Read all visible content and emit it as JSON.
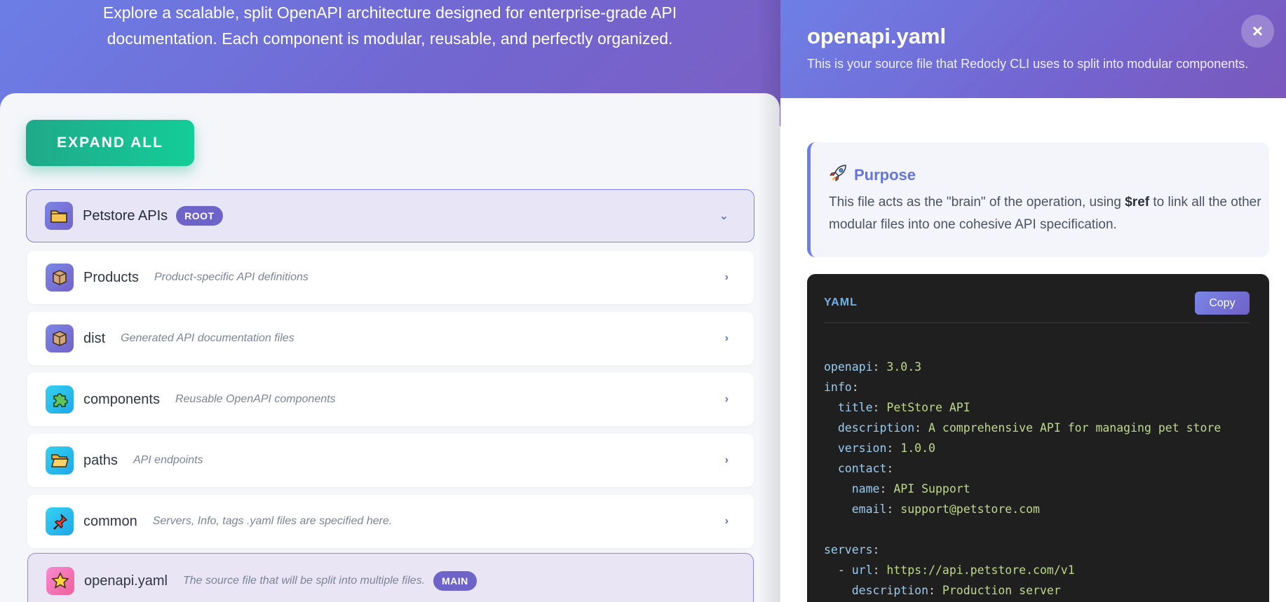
{
  "hero": {
    "line1": "Explore a scalable, split OpenAPI architecture designed for enterprise-grade API",
    "line2": "documentation. Each component is modular, reusable, and perfectly organized."
  },
  "toolbar": {
    "expand_label": "EXPAND ALL"
  },
  "tree": {
    "root": {
      "name": "Petstore APIs",
      "badge": "ROOT",
      "icon": "folder-icon"
    },
    "items": [
      {
        "name": "Products",
        "desc": "Product-specific API definitions",
        "icon": "package-icon"
      },
      {
        "name": "dist",
        "desc": "Generated API documentation files",
        "icon": "package-icon"
      },
      {
        "name": "components",
        "desc": "Reusable OpenAPI components",
        "icon": "puzzle-icon"
      },
      {
        "name": "paths",
        "desc": "API endpoints",
        "icon": "folder-open-icon"
      },
      {
        "name": "common",
        "desc": "Servers, Info, tags .yaml files are specified here.",
        "icon": "pin-icon"
      },
      {
        "name": "openapi.yaml",
        "desc": "The source file that will be split into multiple files.",
        "badge": "MAIN",
        "icon": "star-icon"
      }
    ]
  },
  "drawer": {
    "title": "openapi.yaml",
    "subtitle": "This is your source file that Redocly CLI uses to split into modular components.",
    "close_label": "×",
    "purpose": {
      "title": "Purpose",
      "icon": "rocket-icon",
      "text_before": "This file acts as the \"brain\" of the operation, using ",
      "text_bold": "$ref",
      "text_after": " to link all the other modular files into one cohesive API specification."
    },
    "code": {
      "lang": "YAML",
      "copy_label": "Copy",
      "lines": [
        {
          "indent": "",
          "key": "openapi",
          "value": " 3.0.3"
        },
        {
          "indent": "",
          "key": "info",
          "value": ""
        },
        {
          "indent": "  ",
          "key": "title",
          "value": " PetStore API"
        },
        {
          "indent": "  ",
          "key": "description",
          "value": " A comprehensive API for managing pet store"
        },
        {
          "indent": "  ",
          "key": "version",
          "value": " 1.0.0"
        },
        {
          "indent": "  ",
          "key": "contact",
          "value": ""
        },
        {
          "indent": "    ",
          "key": "name",
          "value": " API Support"
        },
        {
          "indent": "    ",
          "key": "email",
          "value": " support@petstore.com"
        },
        {
          "indent": "",
          "key": "",
          "value": ""
        },
        {
          "indent": "",
          "key": "servers",
          "value": ""
        },
        {
          "indent": "  - ",
          "key": "url",
          "value": " https://api.petstore.com/v1"
        },
        {
          "indent": "    ",
          "key": "description",
          "value": " Production server"
        }
      ]
    }
  },
  "colors": {
    "accent": "#6e63c8",
    "hero_gradient_start": "#6c7ee6",
    "expand_button": "#14cd98",
    "code_bg": "#1f1f1f"
  }
}
